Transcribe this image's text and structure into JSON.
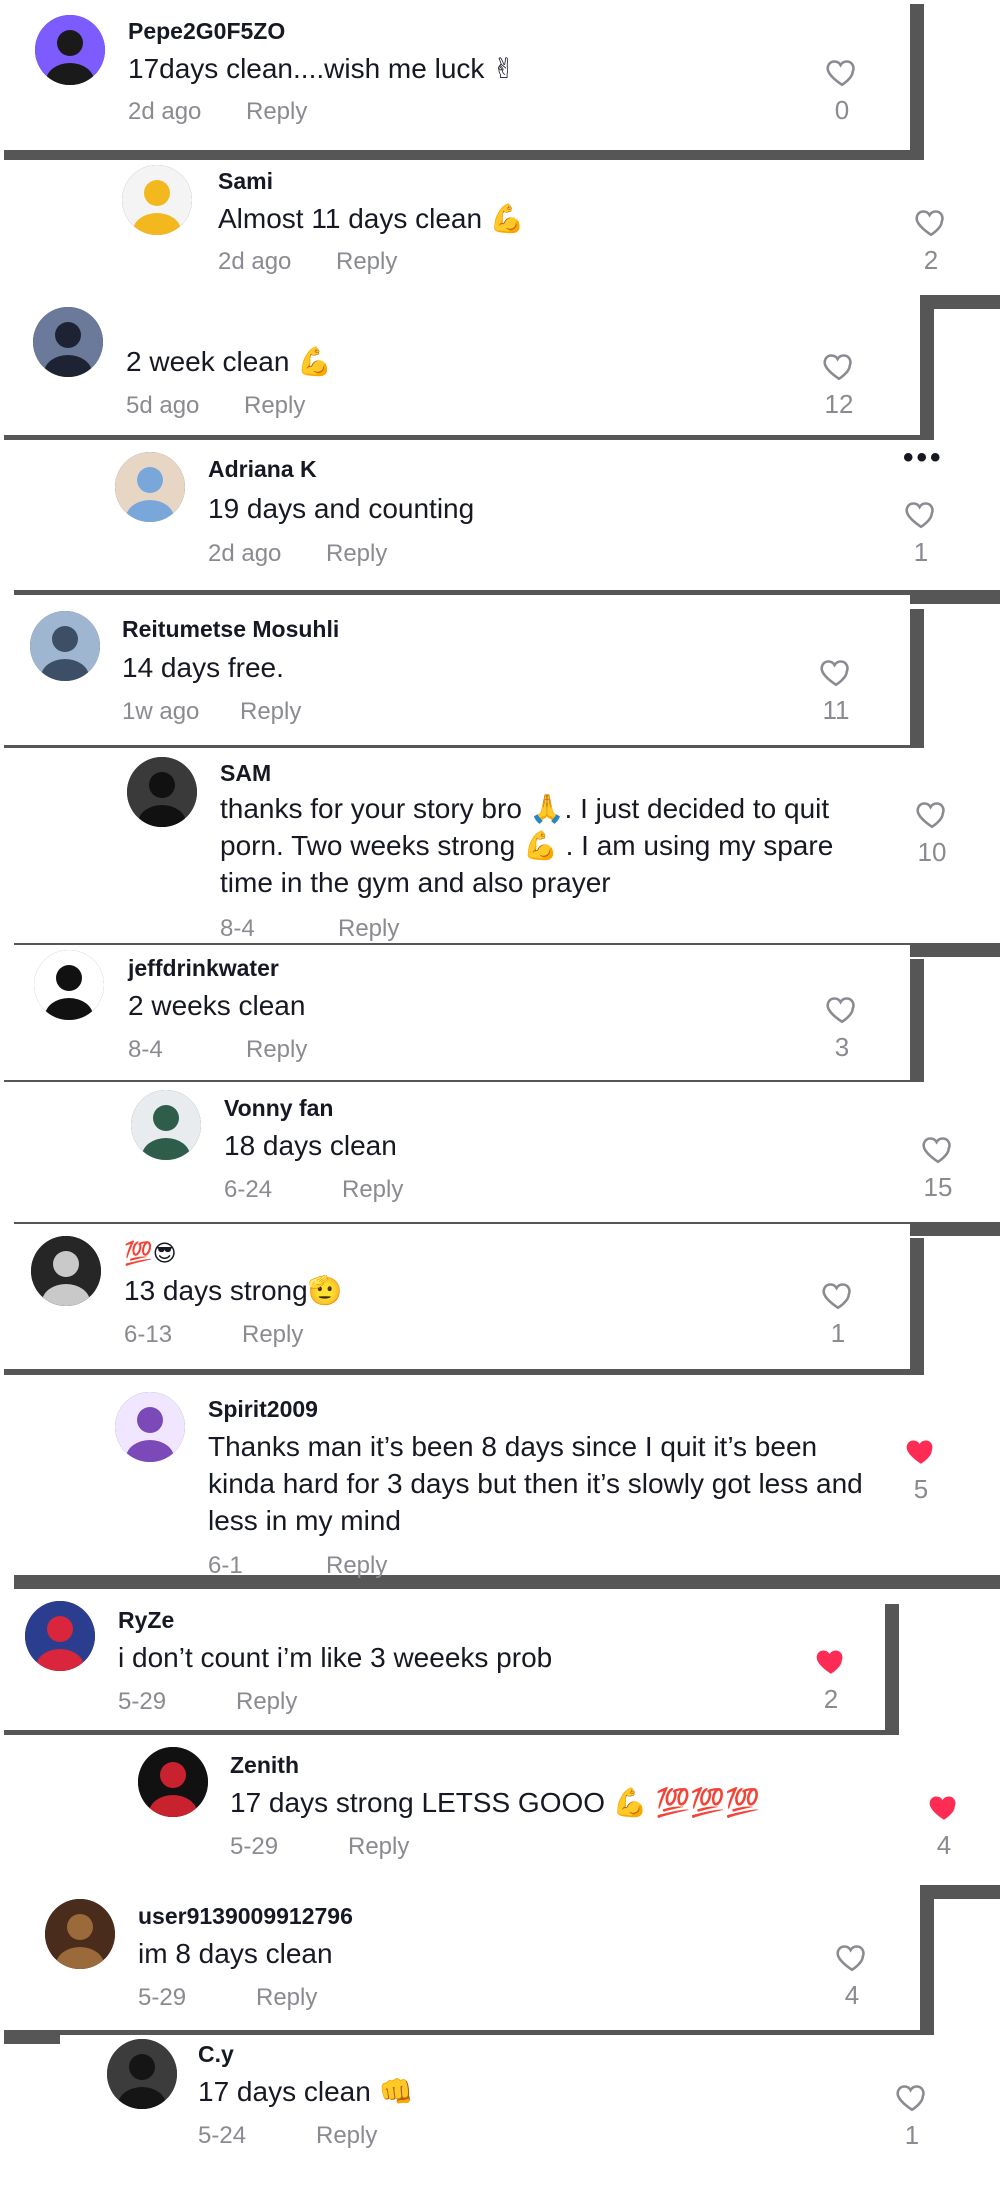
{
  "colors": {
    "liked": "#fe2c55",
    "meta": "#8a8b91",
    "text": "#161823",
    "shadow": "#565656"
  },
  "reply_label": "Reply",
  "more_icon": "more-options-icon",
  "comments": [
    {
      "username": "Pepe2G0F5ZO",
      "text": "17days clean....wish me luck ✌",
      "time": "2d ago",
      "likes": "0",
      "liked": false
    },
    {
      "username": "Sami",
      "text": "Almost 11 days clean 💪",
      "time": "2d ago",
      "likes": "2",
      "liked": false
    },
    {
      "username": "⠀⠀⠀⠀⠀⠀⠀",
      "text": "2 week clean 💪",
      "time": "5d ago",
      "likes": "12",
      "liked": false
    },
    {
      "username": "Adriana K",
      "text": "19 days and counting",
      "time": "2d ago",
      "likes": "1",
      "liked": false
    },
    {
      "username": "Reitumetse Mosuhli",
      "text": "14 days free.",
      "time": "1w ago",
      "likes": "11",
      "liked": false
    },
    {
      "username": "SAM",
      "text": "thanks for your story bro 🙏. I just decided to quit porn. Two weeks strong 💪 . I am using my spare time in the gym and also prayer",
      "time": "8-4",
      "likes": "10",
      "liked": false
    },
    {
      "username": "jeffdrinkwater",
      "text": "2 weeks clean",
      "time": "8-4",
      "likes": "3",
      "liked": false
    },
    {
      "username": "Vonny fan",
      "text": "18 days clean",
      "time": "6-24",
      "likes": "15",
      "liked": false
    },
    {
      "username": "💯😎",
      "text": "13 days strong🫡",
      "time": "6-13",
      "likes": "1",
      "liked": false
    },
    {
      "username": "Spirit2009",
      "text": "Thanks man it’s been 8 days since I quit it’s been kinda hard for 3 days but then it’s slowly got less and less in my mind",
      "time": "6-1",
      "likes": "5",
      "liked": true
    },
    {
      "username": "RyZe",
      "text": "i don’t count i’m like 3 weeeks prob",
      "time": "5-29",
      "likes": "2",
      "liked": true
    },
    {
      "username": "Zenith",
      "text": "17 days strong LETSS GOOO 💪 💯💯💯",
      "time": "5-29",
      "likes": "4",
      "liked": true
    },
    {
      "username": "user9139009912796",
      "text": "im 8 days clean",
      "time": "5-29",
      "likes": "4",
      "liked": false
    },
    {
      "username": "C.y",
      "text": "17 days clean 👊",
      "time": "5-24",
      "likes": "1",
      "liked": false
    }
  ]
}
